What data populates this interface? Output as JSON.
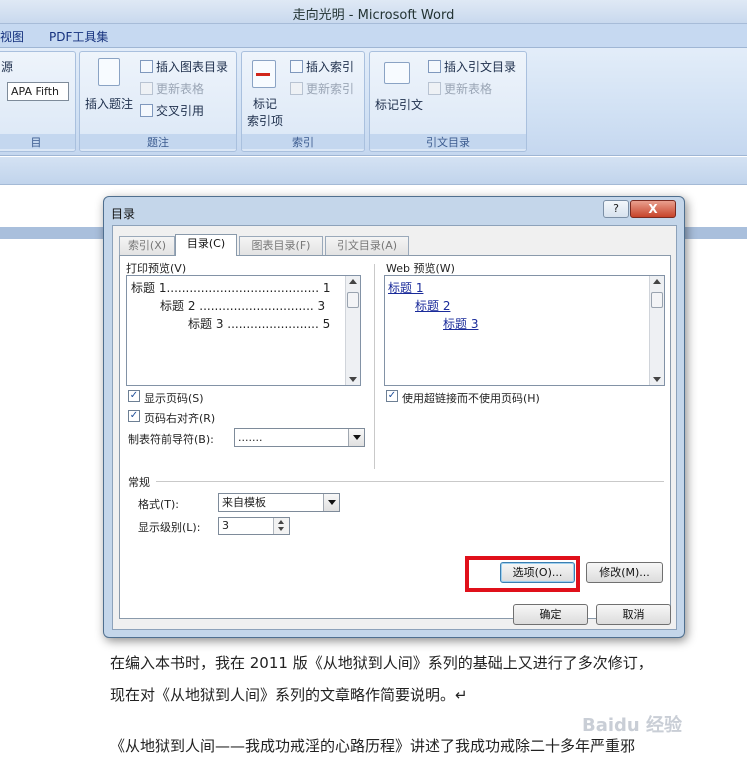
{
  "window": {
    "title": "走向光明 - Microsoft Word"
  },
  "ribbon": {
    "tabs": [
      "视图",
      "PDF工具集"
    ],
    "left_group": {
      "label_top": "源",
      "style_value": "APA Fifth",
      "label_bottom": "目"
    },
    "captions": {
      "insert_caption": "插入题注",
      "insert_table_of_figures": "插入图表目录",
      "update_table": "更新表格",
      "cross_reference": "交叉引用",
      "group_label": "题注"
    },
    "index": {
      "mark_entry_line1": "标记",
      "mark_entry_line2": "索引项",
      "insert_index": "插入索引",
      "update_index": "更新索引",
      "group_label": "索引"
    },
    "authorities": {
      "mark_citation": "标记引文",
      "insert_toa": "插入引文目录",
      "update_table": "更新表格",
      "group_label": "引文目录"
    }
  },
  "dialog": {
    "title": "目录",
    "help": "?",
    "close": "X",
    "tabs": [
      "索引(X)",
      "目录(C)",
      "图表目录(F)",
      "引文目录(A)"
    ],
    "print_preview_label": "打印预览(V)",
    "print_preview_lines": [
      "标题 1........................................ 1",
      "标题 2 .............................. 3",
      "标题 3 ........................ 5"
    ],
    "web_preview_label": "Web 预览(W)",
    "web_preview_lines": [
      "标题 1",
      "标题 2",
      "标题 3"
    ],
    "show_page_numbers": "显示页码(S)",
    "right_align": "页码右对齐(R)",
    "tab_leader_label": "制表符前导符(B):",
    "tab_leader_value": ".......",
    "use_hyperlinks": "使用超链接而不使用页码(H)",
    "general_label": "常规",
    "formats_label": "格式(T):",
    "formats_value": "来自模板",
    "levels_label": "显示级别(L):",
    "levels_value": "3",
    "options_button": "选项(O)...",
    "modify_button": "修改(M)...",
    "ok_button": "确定",
    "cancel_button": "取消"
  },
  "document": {
    "line1": "在编入本书时，我在 2011 版《从地狱到人间》系列的基础上又进行了多次修订，",
    "line2": "现在对《从地狱到人间》系列的文章略作简要说明。↵",
    "line3": "《从地狱到人间——我成功戒淫的心路历程》讲述了我成功戒除二十多年严重邪",
    "watermark": "Baidu 经验"
  },
  "colors": {
    "highlight_box": "#e0101a",
    "accent": "#1a2b9a"
  }
}
